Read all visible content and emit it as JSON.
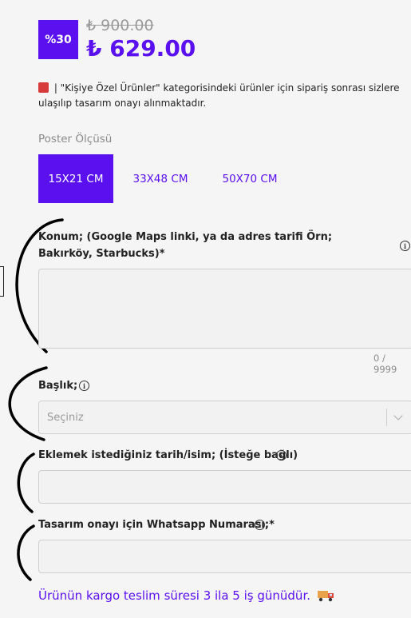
{
  "price": {
    "discount_badge": "%30",
    "old_price": "₺ 900.00",
    "new_price": "₺ 629.00"
  },
  "notice": {
    "icon": "siren-icon",
    "text": " | \"Kişiye Özel Ürünler\" kategorisindeki ürünler için sipariş sonrası sizlere ulaşılıp tasarım onayı alınmaktadır."
  },
  "poster_size": {
    "label": "Poster Ölçüsü",
    "options": [
      "15X21 CM",
      "33X48 CM",
      "50X70 CM"
    ],
    "selected": "15X21 CM"
  },
  "fields": {
    "location": {
      "label": "Konum; (Google Maps linki, ya da adres tarifi Örn; Bakırköy, Starbucks)*",
      "value": "",
      "counter": "0 / 9999"
    },
    "title": {
      "label": "Başlık;",
      "placeholder": "Seçiniz"
    },
    "date_name": {
      "label": "Eklemek istediğiniz tarih/isim; (İsteğe bağlı)",
      "value": ""
    },
    "whatsapp": {
      "label": "Tasarım onayı için Whatsapp Numarası;*",
      "value": ""
    }
  },
  "shipping": {
    "text": "Ürünün kargo teslim süresi 3 ila 5 iş günüdür.",
    "icon": "delivery-truck-icon"
  },
  "colors": {
    "accent": "#5b10f0",
    "text": "#222222",
    "muted": "#8a8a8a",
    "background": "#f5f5f5",
    "input_bg": "#f2f2f2"
  }
}
